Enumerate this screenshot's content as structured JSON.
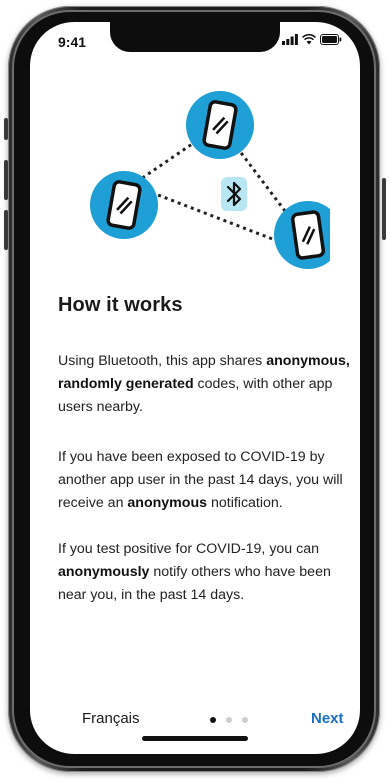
{
  "status_bar": {
    "time": "9:41"
  },
  "illustration": {
    "accent_color": "#1e9fd6",
    "chip_color": "#b8e6f5",
    "icons": [
      "phone-icon",
      "phone-icon",
      "phone-icon",
      "bluetooth-icon"
    ]
  },
  "content": {
    "title": "How it works",
    "para1": {
      "t1": "Using Bluetooth, this app shares ",
      "b1": "anonymous, randomly generated",
      "t2": " codes, with other app users nearby."
    },
    "para2": {
      "t1": "If you have been exposed to COVID-19 by another app user in the past 14 days, you will receive an ",
      "b1": "anonymous",
      "t2": " notification."
    },
    "para3": {
      "t1": "If you test positive for COVID-19, you can ",
      "b1": "anonymously",
      "t2": " notify others who have been near you, in the past 14 days."
    }
  },
  "footer": {
    "language_label": "Français",
    "next_label": "Next",
    "page_indicator": {
      "current": 1,
      "total": 3
    },
    "accent_color": "#1a6ec8"
  }
}
